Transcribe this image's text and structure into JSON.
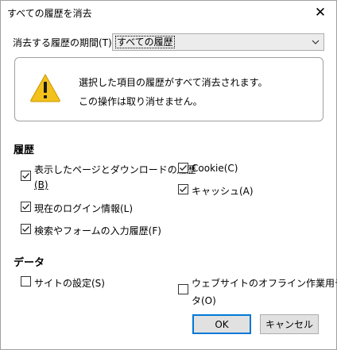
{
  "dialog": {
    "title": "すべての履歴を消去",
    "close_glyph": "✕"
  },
  "range": {
    "label": "消去する履歴の期間(T):",
    "selected": "すべての履歴"
  },
  "warning": {
    "line1": "選択した項目の履歴がすべて消去されます。",
    "line2": "この操作は取り消せません。"
  },
  "history": {
    "heading": "履歴",
    "items": [
      {
        "label_a": "表示したページとダウンロードの履歴",
        "label_b": "(B)",
        "checked": true
      },
      {
        "label": "Cookie(C)",
        "checked": true
      },
      {
        "label": "キャッシュ(A)",
        "checked": true
      },
      {
        "label": "現在のログイン情報(L)",
        "checked": true
      },
      {
        "label": "検索やフォームの入力履歴(F)",
        "checked": true
      }
    ]
  },
  "data": {
    "heading": "データ",
    "items": [
      {
        "label": "サイトの設定(S)",
        "checked": false
      },
      {
        "label_a": "ウェブサイトのオフライン作業用デー",
        "label_b": "タ(O)",
        "checked": false
      }
    ]
  },
  "buttons": {
    "ok": "OK",
    "cancel": "キャンセル"
  },
  "colors": {
    "ok_border": "#0078d7",
    "warning_yellow": "#f2c11b"
  },
  "icons": {
    "warning": "warning-triangle-icon",
    "close": "close-icon",
    "dropdown": "chevron-down-icon",
    "check": "checkmark-icon"
  }
}
